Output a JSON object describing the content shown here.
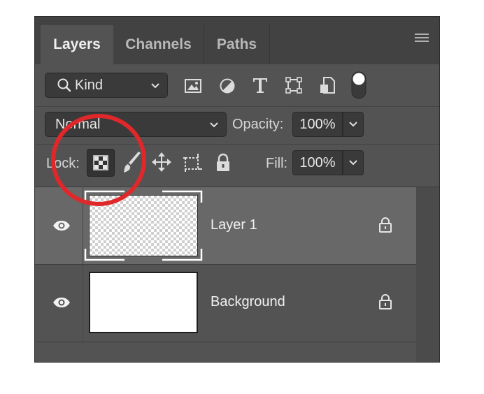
{
  "tabs": [
    {
      "label": "Layers",
      "active": true
    },
    {
      "label": "Channels",
      "active": false
    },
    {
      "label": "Paths",
      "active": false
    }
  ],
  "filter": {
    "selected": "Kind",
    "icon": "search-icon"
  },
  "blend": {
    "mode": "Normal",
    "opacity_label": "Opacity:",
    "opacity_value": "100%"
  },
  "lock": {
    "label": "Lock:",
    "fill_label": "Fill:",
    "fill_value": "100%"
  },
  "layers": [
    {
      "name": "Layer 1",
      "selected": true,
      "thumbnail": "transparent",
      "locked": true
    },
    {
      "name": "Background",
      "selected": false,
      "thumbnail": "white",
      "locked": true
    }
  ],
  "annotation": {
    "color": "#e0282a"
  },
  "colors": {
    "panel": "#535353",
    "tabbar": "#424242",
    "selected_row": "#686868"
  }
}
